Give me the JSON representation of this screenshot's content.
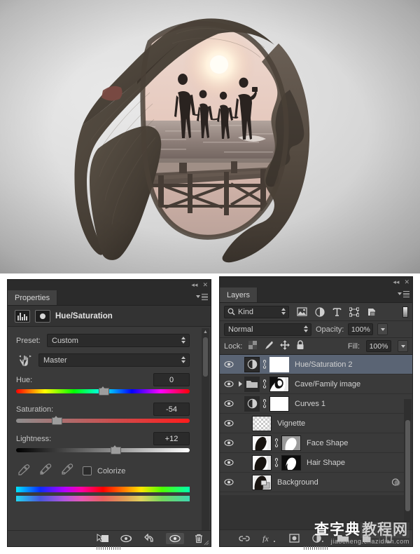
{
  "artwork": {
    "name": "double-exposure-portrait",
    "description": "Silhouette of a woman's head in profile with a family beach sunset double exposure inside",
    "colors": {
      "background": "#d9d9d9",
      "hair": "#4a4238",
      "sky": "#e7cfc6",
      "sea": "#9c8b84",
      "sun": "#fff6e8",
      "hairtie": "#7a4a42"
    }
  },
  "properties_panel": {
    "title": "Properties",
    "adjustment_title": "Hue/Saturation",
    "close_label": "✕",
    "collapse_label": "◂◂",
    "preset": {
      "label": "Preset:",
      "value": "Custom"
    },
    "channel": {
      "value": "Master"
    },
    "sliders": [
      {
        "label": "Hue:",
        "value": "0",
        "knob_pct": 50,
        "track": "hue"
      },
      {
        "label": "Saturation:",
        "value": "-54",
        "knob_pct": 23,
        "track": "sat"
      },
      {
        "label": "Lightness:",
        "value": "+12",
        "knob_pct": 57,
        "track": "light"
      }
    ],
    "colorize": {
      "label": "Colorize",
      "checked": false
    },
    "eyedroppers": [
      "eyedropper-icon",
      "eyedropper-plus-icon",
      "eyedropper-minus-icon"
    ],
    "footer_icons": [
      "clip-to-layer-icon",
      "view-previous-state-icon",
      "reset-icon",
      "toggle-visibility-icon",
      "delete-icon"
    ]
  },
  "layers_panel": {
    "title": "Layers",
    "close_label": "✕",
    "collapse_label": "◂◂",
    "filter": {
      "kind_label": "Kind",
      "icons": [
        "pixel-layer-filter-icon",
        "adjustment-layer-filter-icon",
        "type-layer-filter-icon",
        "shape-layer-filter-icon",
        "smart-object-filter-icon"
      ]
    },
    "blend": {
      "mode": "Normal",
      "opacity_label": "Opacity:",
      "opacity_value": "100%"
    },
    "lock": {
      "label": "Lock:",
      "icons": [
        "lock-transparency-icon",
        "lock-image-icon",
        "lock-position-icon",
        "lock-all-icon"
      ],
      "fill_label": "Fill:",
      "fill_value": "100%"
    },
    "layers": [
      {
        "name": "Hue/Saturation 2",
        "selected": true,
        "kind": "adjustment",
        "has_mask": true,
        "linked": true,
        "mask_style": "white"
      },
      {
        "name": "Cave/Family image",
        "selected": false,
        "kind": "group",
        "has_mask": true,
        "linked": true,
        "mask_style": "portrait"
      },
      {
        "name": "Curves 1",
        "selected": false,
        "kind": "adjustment",
        "has_mask": true,
        "linked": true,
        "mask_style": "white"
      },
      {
        "name": "Vignette",
        "selected": false,
        "kind": "pixel",
        "has_mask": false,
        "linked": false,
        "mask_style": "checker"
      },
      {
        "name": "Face Shape",
        "selected": false,
        "kind": "pixel",
        "has_mask": true,
        "linked": true,
        "mask_style": "face"
      },
      {
        "name": "Hair Shape",
        "selected": false,
        "kind": "pixel",
        "has_mask": true,
        "linked": true,
        "mask_style": "hair"
      },
      {
        "name": "Background",
        "selected": false,
        "kind": "background",
        "has_mask": false,
        "linked": false,
        "mask_style": "none"
      }
    ],
    "footer_icons": [
      "link-layers-icon",
      "layer-style-fx-icon",
      "add-mask-icon",
      "new-adjustment-layer-icon",
      "new-group-icon",
      "new-layer-icon",
      "delete-layer-icon"
    ]
  },
  "watermark": {
    "main_left": "查字典",
    "main_right": "教程网",
    "sub": "jiaocheng.chazidian.com"
  }
}
